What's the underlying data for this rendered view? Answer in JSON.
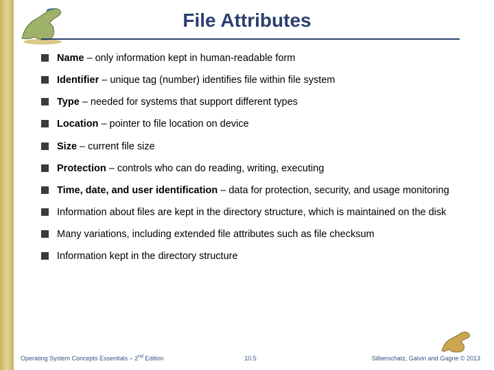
{
  "title": "File Attributes",
  "bullets": [
    {
      "bold": "Name",
      "rest": " – only information kept in human-readable form"
    },
    {
      "bold": "Identifier",
      "rest": " – unique tag (number) identifies file within file system"
    },
    {
      "bold": "Type",
      "rest": " – needed for systems that support different types"
    },
    {
      "bold": "Location",
      "rest": " – pointer to file location on device"
    },
    {
      "bold": "Size",
      "rest": " – current file size"
    },
    {
      "bold": "Protection",
      "rest": " – controls who can do reading, writing, executing"
    },
    {
      "bold": "Time, date, and user identification",
      "rest": " – data for protection, security, and usage monitoring"
    },
    {
      "bold": "",
      "rest": "Information about files are kept in the directory structure, which is maintained on the disk"
    },
    {
      "bold": "",
      "rest": "Many variations, including extended file attributes such as file checksum"
    },
    {
      "bold": "",
      "rest": "Information kept in the directory structure"
    }
  ],
  "footer": {
    "left_a": "Operating System Concepts Essentials – 2",
    "left_sup": "nd",
    "left_b": " Edition",
    "center": "10.5",
    "right": "Silberschatz, Galvin and Gagne © 2013"
  }
}
